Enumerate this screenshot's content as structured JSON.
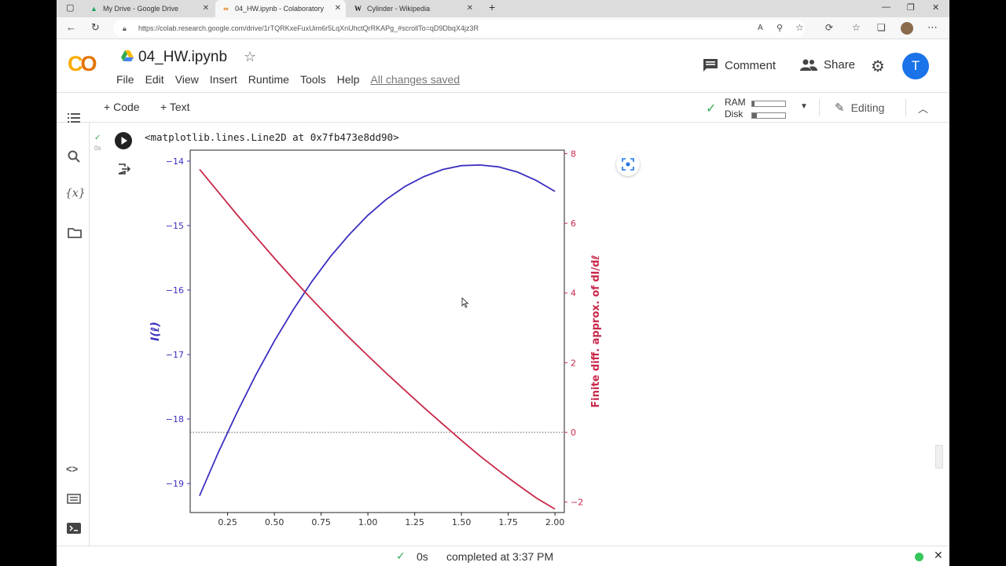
{
  "browser": {
    "tabs": [
      {
        "title": "My Drive - Google Drive",
        "icon": "google-drive-icon"
      },
      {
        "title": "04_HW.ipynb - Colaboratory",
        "icon": "colab-icon"
      },
      {
        "title": "Cylinder - Wikipedia",
        "icon": "wikipedia-icon"
      }
    ],
    "url": "https://colab.research.google.com/drive/1rTQRKxeFuxUim6r5LqXnUhctQrRKAPg_#scrollTo=qD9DbqX4jz3R"
  },
  "header": {
    "logo": "CO",
    "notebook_title": "04_HW.ipynb",
    "menu": [
      "File",
      "Edit",
      "View",
      "Insert",
      "Runtime",
      "Tools",
      "Help"
    ],
    "save_status": "All changes saved",
    "comment_label": "Comment",
    "share_label": "Share",
    "avatar_letter": "T"
  },
  "toolbar": {
    "add_code": "Code",
    "add_text": "Text",
    "ram_label": "RAM",
    "disk_label": "Disk",
    "ram_level": 0.08,
    "disk_level": 0.15,
    "mode_label": "Editing"
  },
  "cell": {
    "exec_time": "0s",
    "output_text": "<matplotlib.lines.Line2D at 0x7fb473e8dd90>"
  },
  "status": {
    "check": "✓",
    "duration": "0s",
    "completed": "completed at 3:37 PM"
  },
  "colors": {
    "blue_series": "#3c30c0",
    "red_series": "#c8284a",
    "accent": "#1a73e8"
  },
  "chart_data": {
    "type": "line",
    "x_ticks": [
      "0.25",
      "0.50",
      "0.75",
      "1.00",
      "1.25",
      "1.50",
      "1.75",
      "2.00"
    ],
    "xlim": [
      0.05,
      2.05
    ],
    "left_axis": {
      "label": "I(ℓ)",
      "ticks": [
        "−14",
        "−15",
        "−16",
        "−17",
        "−18",
        "−19"
      ],
      "tick_values": [
        -14,
        -15,
        -16,
        -17,
        -18,
        -19
      ],
      "ylim": [
        -19.45,
        -13.83
      ]
    },
    "right_axis": {
      "label": "Finite diff. approx. of dI/dℓ",
      "ticks": [
        "8",
        "6",
        "4",
        "2",
        "0",
        "−2"
      ],
      "tick_values": [
        8,
        6,
        4,
        2,
        0,
        -2
      ],
      "ylim": [
        -2.3,
        8.1
      ]
    },
    "series": [
      {
        "axis": "left",
        "x": [
          0.1,
          0.2,
          0.3,
          0.4,
          0.5,
          0.6,
          0.7,
          0.8,
          0.9,
          1.0,
          1.1,
          1.2,
          1.3,
          1.4,
          1.5,
          1.6,
          1.7,
          1.8,
          1.9,
          2.0
        ],
        "y": [
          -19.19,
          -18.52,
          -17.9,
          -17.32,
          -16.79,
          -16.31,
          -15.87,
          -15.48,
          -15.14,
          -14.84,
          -14.59,
          -14.39,
          -14.24,
          -14.13,
          -14.07,
          -14.06,
          -14.09,
          -14.17,
          -14.3,
          -14.47
        ]
      },
      {
        "axis": "right",
        "x": [
          0.1,
          0.2,
          0.3,
          0.4,
          0.5,
          0.6,
          0.7,
          0.8,
          0.9,
          1.0,
          1.1,
          1.2,
          1.3,
          1.4,
          1.5,
          1.6,
          1.7,
          1.8,
          1.9,
          2.0
        ],
        "y": [
          7.55,
          6.9,
          6.25,
          5.62,
          5.0,
          4.4,
          3.82,
          3.26,
          2.72,
          2.2,
          1.69,
          1.2,
          0.71,
          0.24,
          -0.23,
          -0.68,
          -1.1,
          -1.5,
          -1.88,
          -2.2
        ]
      }
    ],
    "reference_line": {
      "axis": "right",
      "y": 0,
      "style": "dotted"
    }
  }
}
